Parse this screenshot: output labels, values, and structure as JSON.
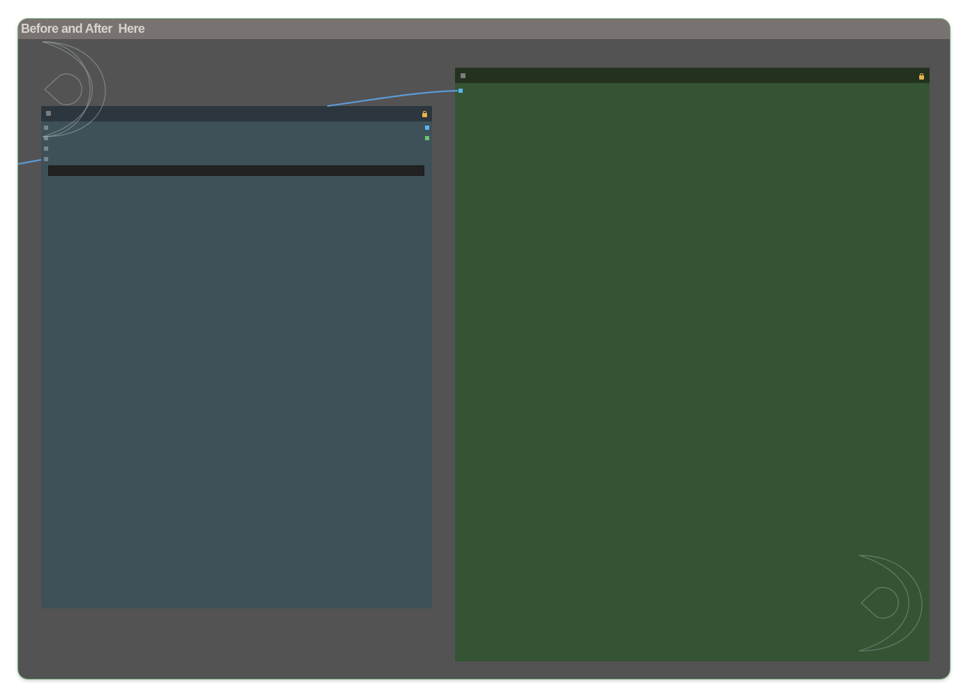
{
  "group": {
    "title": "Before and After  Here"
  },
  "colors": {
    "canvas_bg": "#535353",
    "group_title_bg": "#787370",
    "group_border": "#7fb384",
    "left_node_header": "#2b363e",
    "left_node_body": "#3e5058",
    "right_node_header": "#22321f",
    "right_node_body": "#355433",
    "link_blue": "#5b9bd5",
    "slot_blue": "#5fb3f0",
    "slot_green": "#6fc36f",
    "slot_gray": "#7a8790",
    "lock_yellow": "#e8b34b",
    "widget_bg": "#222222"
  },
  "icons": {
    "collapse": "square-dot-icon",
    "lock": "lock-icon",
    "logo": "crescent-logo-icon"
  }
}
